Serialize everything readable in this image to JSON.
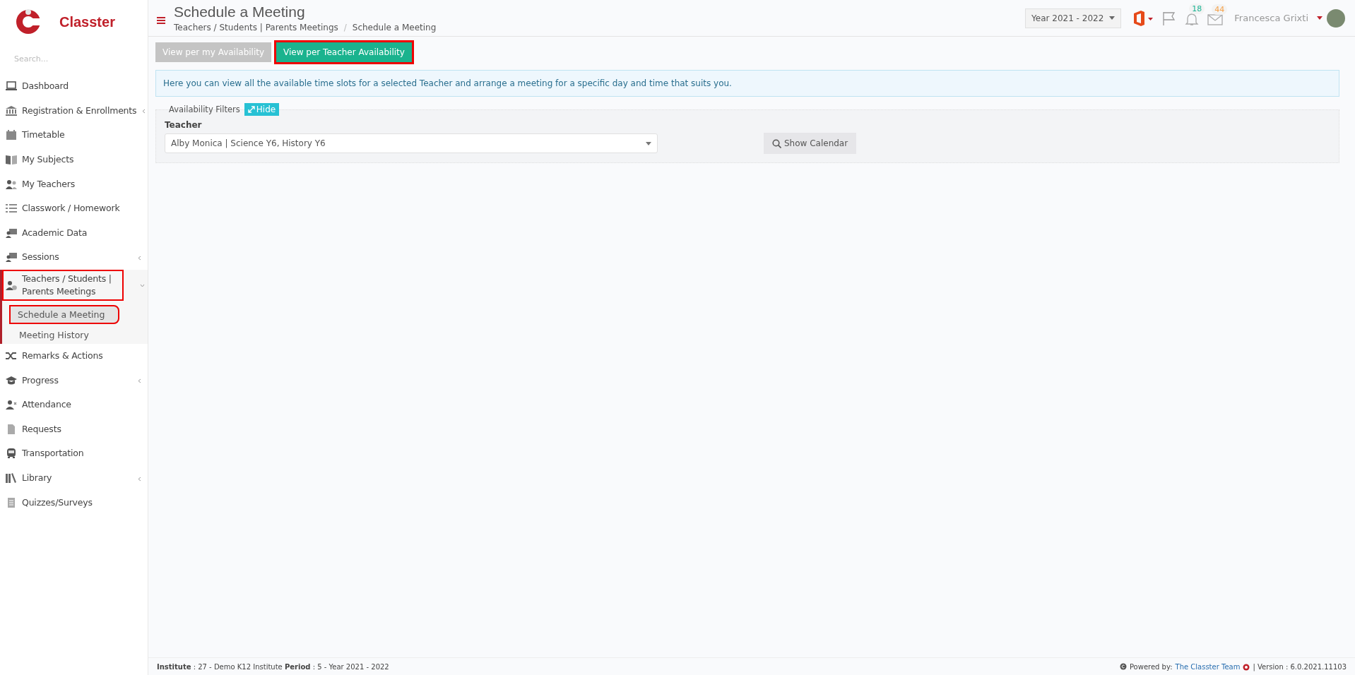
{
  "brand": {
    "name": "Classter"
  },
  "search": {
    "placeholder": "Search..."
  },
  "sidebar": {
    "items": [
      {
        "label": "Dashboard",
        "submenu": false,
        "highlighted": false
      },
      {
        "label": "Registration & Enrollments",
        "submenu": true,
        "expanded": false,
        "highlighted": false
      },
      {
        "label": "Timetable",
        "submenu": false,
        "highlighted": false
      },
      {
        "label": "My Subjects",
        "submenu": false,
        "highlighted": false
      },
      {
        "label": "My Teachers",
        "submenu": false,
        "highlighted": false
      },
      {
        "label": "Classwork / Homework",
        "submenu": false,
        "highlighted": false
      },
      {
        "label": "Academic Data",
        "submenu": false,
        "highlighted": false
      },
      {
        "label": "Sessions",
        "submenu": true,
        "expanded": false,
        "highlighted": false
      },
      {
        "label": "Teachers / Students | Parents Meetings",
        "submenu": true,
        "expanded": true,
        "highlighted": true,
        "children": [
          {
            "label": "Schedule a Meeting",
            "selected": true,
            "highlighted": true
          },
          {
            "label": "Meeting History",
            "selected": false,
            "highlighted": false
          }
        ]
      },
      {
        "label": "Remarks & Actions",
        "submenu": false,
        "highlighted": false
      },
      {
        "label": "Progress",
        "submenu": true,
        "expanded": false,
        "highlighted": false
      },
      {
        "label": "Attendance",
        "submenu": false,
        "highlighted": false
      },
      {
        "label": "Requests",
        "submenu": false,
        "highlighted": false
      },
      {
        "label": "Transportation",
        "submenu": false,
        "highlighted": false
      },
      {
        "label": "Library",
        "submenu": true,
        "expanded": false,
        "highlighted": false
      },
      {
        "label": "Quizzes/Surveys",
        "submenu": false,
        "highlighted": false
      }
    ]
  },
  "header": {
    "title": "Schedule a Meeting",
    "breadcrumb": [
      "Teachers / Students | Parents Meetings",
      "Schedule a Meeting"
    ],
    "breadcrumb_separator": "/",
    "year": "Year 2021 - 2022",
    "notifications": "18",
    "messages": "44",
    "user": "Francesca Grixti"
  },
  "view_tabs": [
    {
      "label": "View per my Availability",
      "selected": false,
      "highlighted": false
    },
    {
      "label": "View per Teacher Availability",
      "selected": true,
      "highlighted": true
    }
  ],
  "info": "Here you can view all the available time slots for a selected Teacher and arrange a meeting for a specific day and time that suits you.",
  "filters": {
    "title": "Availability Filters",
    "toggle": "Hide",
    "teacher_label": "Teacher",
    "teacher_value": "Alby Monica | Science Y6, History Y6",
    "button": "Show Calendar"
  },
  "footer": {
    "institute_label": "Institute",
    "institute": ": 27 - Demo K12 Institute",
    "period_label": "Period",
    "period": ": 5 - Year 2021 - 2022",
    "powered": "Powered by:",
    "team": "The Classter Team",
    "version": "| Version : 6.0.2021.11103"
  }
}
